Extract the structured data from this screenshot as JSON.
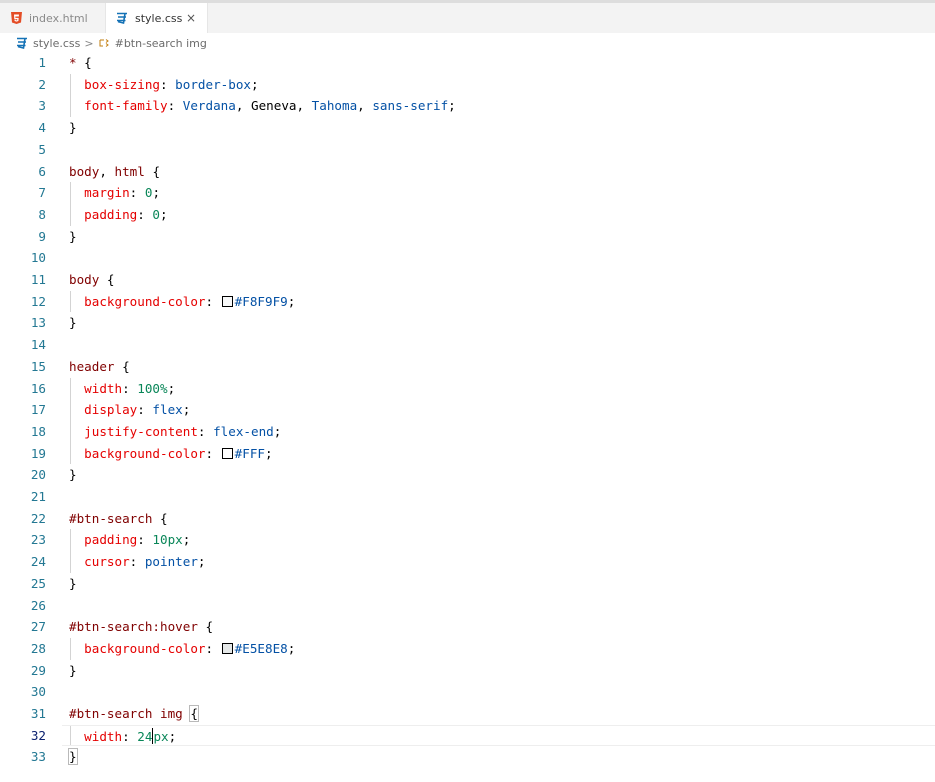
{
  "tabs": [
    {
      "label": "index.html",
      "icon": "html5-icon",
      "active": false
    },
    {
      "label": "style.css",
      "icon": "css3-icon",
      "active": true,
      "close": "×"
    }
  ],
  "breadcrumb": {
    "file": "style.css",
    "separator": ">",
    "symbol": "#btn-search img"
  },
  "colors": {
    "html_icon": "#e44d26",
    "css_icon": "#1572b6",
    "line_number": "#237893",
    "selector": "#800000",
    "property": "#e50000",
    "value": "#0451a5",
    "number": "#098658"
  },
  "lines": [
    {
      "n": "1",
      "tokens": [
        [
          "sel",
          "* "
        ],
        [
          "plain",
          "{"
        ]
      ]
    },
    {
      "n": "2",
      "indent": true,
      "tokens": [
        [
          "prop",
          "box-sizing"
        ],
        [
          "plain",
          ": "
        ],
        [
          "val",
          "border-box"
        ],
        [
          "plain",
          ";"
        ]
      ]
    },
    {
      "n": "3",
      "indent": true,
      "tokens": [
        [
          "prop",
          "font-family"
        ],
        [
          "plain",
          ": "
        ],
        [
          "val",
          "Verdana"
        ],
        [
          "plain",
          ", Geneva, "
        ],
        [
          "val",
          "Tahoma"
        ],
        [
          "plain",
          ", "
        ],
        [
          "val",
          "sans-serif"
        ],
        [
          "plain",
          ";"
        ]
      ]
    },
    {
      "n": "4",
      "tokens": [
        [
          "plain",
          "}"
        ]
      ]
    },
    {
      "n": "5",
      "tokens": []
    },
    {
      "n": "6",
      "tokens": [
        [
          "sel",
          "body"
        ],
        [
          "plain",
          ", "
        ],
        [
          "sel",
          "html "
        ],
        [
          "plain",
          "{"
        ]
      ]
    },
    {
      "n": "7",
      "indent": true,
      "tokens": [
        [
          "prop",
          "margin"
        ],
        [
          "plain",
          ": "
        ],
        [
          "num",
          "0"
        ],
        [
          "plain",
          ";"
        ]
      ]
    },
    {
      "n": "8",
      "indent": true,
      "tokens": [
        [
          "prop",
          "padding"
        ],
        [
          "plain",
          ": "
        ],
        [
          "num",
          "0"
        ],
        [
          "plain",
          ";"
        ]
      ]
    },
    {
      "n": "9",
      "tokens": [
        [
          "plain",
          "}"
        ]
      ]
    },
    {
      "n": "10",
      "tokens": []
    },
    {
      "n": "11",
      "tokens": [
        [
          "sel",
          "body "
        ],
        [
          "plain",
          "{"
        ]
      ]
    },
    {
      "n": "12",
      "indent": true,
      "tokens": [
        [
          "prop",
          "background-color"
        ],
        [
          "plain",
          ": "
        ],
        [
          "swatch",
          "#F8F9F9"
        ],
        [
          "val",
          "#F8F9F9"
        ],
        [
          "plain",
          ";"
        ]
      ]
    },
    {
      "n": "13",
      "tokens": [
        [
          "plain",
          "}"
        ]
      ]
    },
    {
      "n": "14",
      "tokens": []
    },
    {
      "n": "15",
      "tokens": [
        [
          "sel",
          "header "
        ],
        [
          "plain",
          "{"
        ]
      ]
    },
    {
      "n": "16",
      "indent": true,
      "tokens": [
        [
          "prop",
          "width"
        ],
        [
          "plain",
          ": "
        ],
        [
          "num",
          "100%"
        ],
        [
          "plain",
          ";"
        ]
      ]
    },
    {
      "n": "17",
      "indent": true,
      "tokens": [
        [
          "prop",
          "display"
        ],
        [
          "plain",
          ": "
        ],
        [
          "val",
          "flex"
        ],
        [
          "plain",
          ";"
        ]
      ]
    },
    {
      "n": "18",
      "indent": true,
      "tokens": [
        [
          "prop",
          "justify-content"
        ],
        [
          "plain",
          ": "
        ],
        [
          "val",
          "flex-end"
        ],
        [
          "plain",
          ";"
        ]
      ]
    },
    {
      "n": "19",
      "indent": true,
      "tokens": [
        [
          "prop",
          "background-color"
        ],
        [
          "plain",
          ": "
        ],
        [
          "swatch",
          "#FFF"
        ],
        [
          "val",
          "#FFF"
        ],
        [
          "plain",
          ";"
        ]
      ]
    },
    {
      "n": "20",
      "tokens": [
        [
          "plain",
          "}"
        ]
      ]
    },
    {
      "n": "21",
      "tokens": []
    },
    {
      "n": "22",
      "tokens": [
        [
          "sel",
          "#btn-search "
        ],
        [
          "plain",
          "{"
        ]
      ]
    },
    {
      "n": "23",
      "indent": true,
      "tokens": [
        [
          "prop",
          "padding"
        ],
        [
          "plain",
          ": "
        ],
        [
          "num",
          "10px"
        ],
        [
          "plain",
          ";"
        ]
      ]
    },
    {
      "n": "24",
      "indent": true,
      "tokens": [
        [
          "prop",
          "cursor"
        ],
        [
          "plain",
          ": "
        ],
        [
          "val",
          "pointer"
        ],
        [
          "plain",
          ";"
        ]
      ]
    },
    {
      "n": "25",
      "tokens": [
        [
          "plain",
          "}"
        ]
      ]
    },
    {
      "n": "26",
      "tokens": []
    },
    {
      "n": "27",
      "tokens": [
        [
          "sel",
          "#btn-search:hover "
        ],
        [
          "plain",
          "{"
        ]
      ]
    },
    {
      "n": "28",
      "indent": true,
      "tokens": [
        [
          "prop",
          "background-color"
        ],
        [
          "plain",
          ": "
        ],
        [
          "swatch",
          "#E5E8E8"
        ],
        [
          "val",
          "#E5E8E8"
        ],
        [
          "plain",
          ";"
        ]
      ]
    },
    {
      "n": "29",
      "tokens": [
        [
          "plain",
          "}"
        ]
      ]
    },
    {
      "n": "30",
      "tokens": []
    },
    {
      "n": "31",
      "tokens": [
        [
          "sel",
          "#btn-search img "
        ],
        [
          "bracket",
          "{"
        ]
      ]
    },
    {
      "n": "32",
      "indent": true,
      "current": true,
      "tokens": [
        [
          "prop",
          "width"
        ],
        [
          "plain",
          ": "
        ],
        [
          "num",
          "24"
        ],
        [
          "caret",
          ""
        ],
        [
          "num",
          "px"
        ],
        [
          "plain",
          ";"
        ]
      ]
    },
    {
      "n": "33",
      "tokens": [
        [
          "bracket",
          "}"
        ]
      ]
    }
  ]
}
